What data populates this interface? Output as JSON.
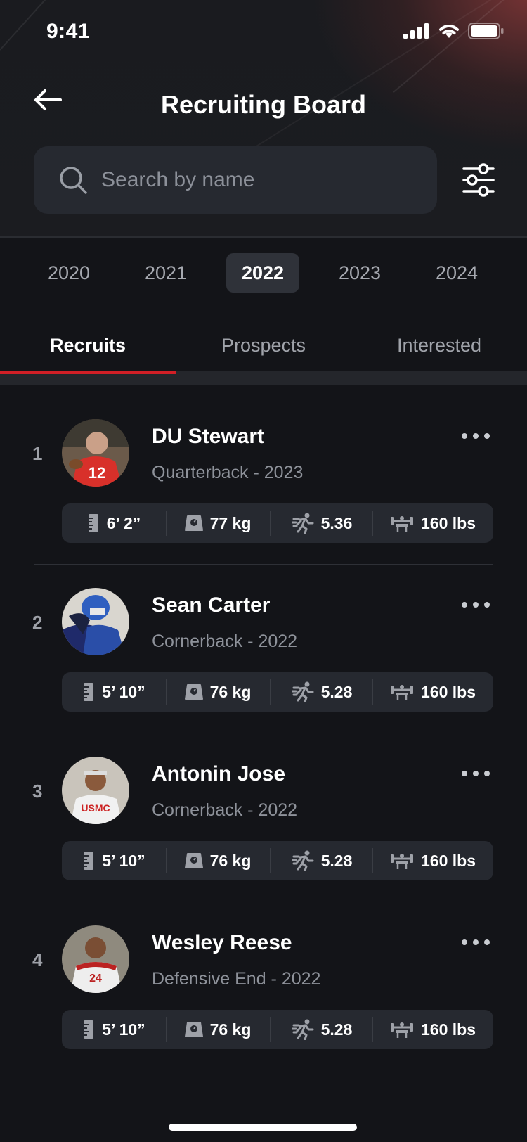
{
  "status_bar": {
    "time": "9:41"
  },
  "header": {
    "title": "Recruiting Board"
  },
  "search": {
    "placeholder": "Search by name"
  },
  "years": [
    "2020",
    "2021",
    "2022",
    "2023",
    "2024"
  ],
  "selected_year": "2022",
  "tabs": [
    "Recruits",
    "Prospects",
    "Interested"
  ],
  "active_tab": "Recruits",
  "colors": {
    "accent": "#d11f26",
    "background": "#131418",
    "card": "#262930"
  },
  "recruits": [
    {
      "rank": "1",
      "name": "DU Stewart",
      "subtitle": "Quarterback - 2023",
      "height": "6’ 2”",
      "weight": "77 kg",
      "forty": "5.36",
      "bench": "160 lbs",
      "avatar": "red-jersey-12"
    },
    {
      "rank": "2",
      "name": "Sean Carter",
      "subtitle": "Cornerback - 2022",
      "height": "5’ 10”",
      "weight": "76 kg",
      "forty": "5.28",
      "bench": "160 lbs",
      "avatar": "blue-helmet"
    },
    {
      "rank": "3",
      "name": "Antonin Jose",
      "subtitle": "Cornerback - 2022",
      "height": "5’ 10”",
      "weight": "76 kg",
      "forty": "5.28",
      "bench": "160 lbs",
      "avatar": "white-jersey-usmc"
    },
    {
      "rank": "4",
      "name": "Wesley Reese",
      "subtitle": "Defensive End - 2022",
      "height": "5’ 10”",
      "weight": "76 kg",
      "forty": "5.28",
      "bench": "160 lbs",
      "avatar": "white-jersey-24"
    }
  ]
}
